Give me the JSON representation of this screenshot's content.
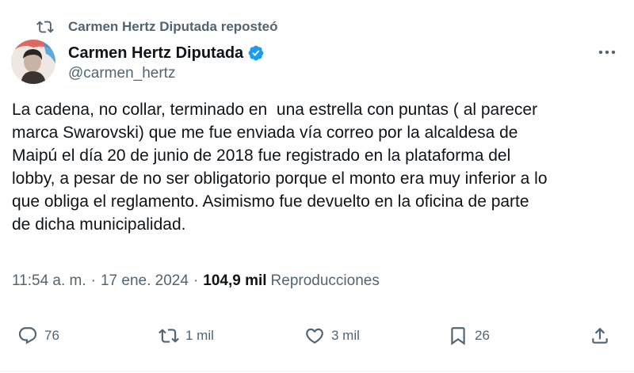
{
  "repost": {
    "label": "Carmen Hertz Diputada reposteó",
    "icon": "repost-icon"
  },
  "author": {
    "name": "Carmen Hertz Diputada",
    "handle": "@carmen_hertz",
    "verified_icon": "verified-badge-icon",
    "verified_color": "#1d9bf0"
  },
  "tweet": {
    "text": "La cadena, no collar, terminado en  una estrella con puntas ( al parecer\nmarca Swarovski) que me fue enviada vía correo por la alcaldesa de\nMaipú el día 20 de junio de 2018 fue registrado en la plataforma del\nlobby, a pesar de no ser obligatorio porque el monto era muy inferior a lo\nque obliga el reglamento. Asimismo fue devuelto en la oficina de parte\nde dicha municipalidad."
  },
  "meta": {
    "time": "11:54 a. m.",
    "separator": "·",
    "date": "17 ene. 2024",
    "separator2": "·",
    "views_count": "104,9 mil",
    "views_label": "Reproducciones"
  },
  "actions": {
    "reply": {
      "icon": "reply-icon",
      "count": "76"
    },
    "repost": {
      "icon": "repost-icon",
      "count": "1 mil"
    },
    "like": {
      "icon": "heart-icon",
      "count": "3 mil"
    },
    "bookmark": {
      "icon": "bookmark-icon",
      "count": "26"
    },
    "share": {
      "icon": "share-icon"
    }
  },
  "colors": {
    "text_primary": "#0f1419",
    "text_secondary": "#536471",
    "accent": "#1d9bf0"
  }
}
